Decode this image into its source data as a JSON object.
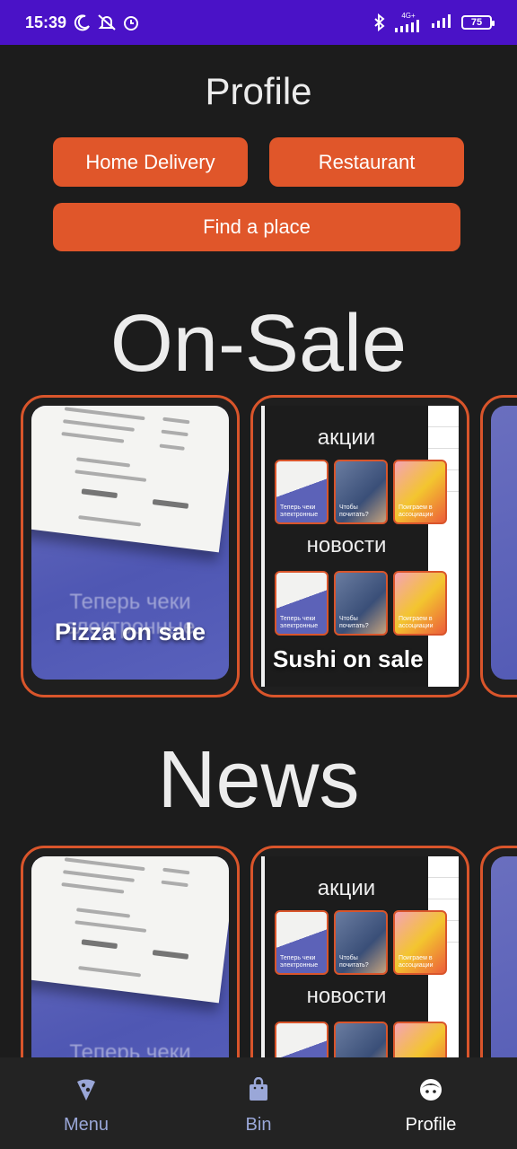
{
  "status_bar": {
    "time": "15:39",
    "network_label": "4G+",
    "battery": "75"
  },
  "header": {
    "title": "Profile",
    "buttons": {
      "home_delivery": "Home Delivery",
      "restaurant": "Restaurant",
      "find_place": "Find a place"
    }
  },
  "sections": {
    "on_sale": {
      "title": "On-Sale",
      "cards": [
        {
          "label": "Pizza on sale",
          "image_caption": "Теперь чеки электронные"
        },
        {
          "label": "Sushi on sale",
          "image_headings": [
            "акции",
            "новости"
          ],
          "thumb_captions": [
            "Теперь чеки электронные",
            "Чтобы почитать?",
            "Поиграем в ассоциации"
          ]
        }
      ]
    },
    "news": {
      "title": "News",
      "cards": [
        {
          "image_caption": "Теперь чеки"
        },
        {
          "image_headings": [
            "акции",
            "новости"
          ],
          "thumb_captions": [
            "Теперь чеки электронные",
            "Чтобы почитать?",
            "Поиграем в ассоциации"
          ]
        }
      ]
    }
  },
  "bottom_nav": {
    "items": [
      {
        "label": "Menu",
        "icon": "pizza-icon"
      },
      {
        "label": "Bin",
        "icon": "bag-icon"
      },
      {
        "label": "Profile",
        "icon": "face-icon",
        "active": true
      }
    ]
  },
  "colors": {
    "status_bar": "#4a12c7",
    "accent": "#e0562a",
    "background": "#1c1c1c",
    "nav_inactive": "#9aa7d8"
  }
}
